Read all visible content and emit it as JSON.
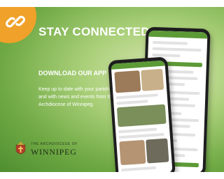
{
  "promo": {
    "headline": "STAY CONNECTED",
    "subhead": "DOWNLOAD OUR APP",
    "body": "Keep up to date with your parish and with news and events from the Archdiocese of Winnipeg.",
    "org_top": "THE ARCHDIOCESE OF",
    "org_name": "WINNIPEG"
  },
  "icons": {
    "link": "link-icon",
    "crest": "crest-icon"
  },
  "colors": {
    "accent": "#f0a12a",
    "brand_green": "#5c9a36",
    "text_on_green": "#ffffff"
  }
}
